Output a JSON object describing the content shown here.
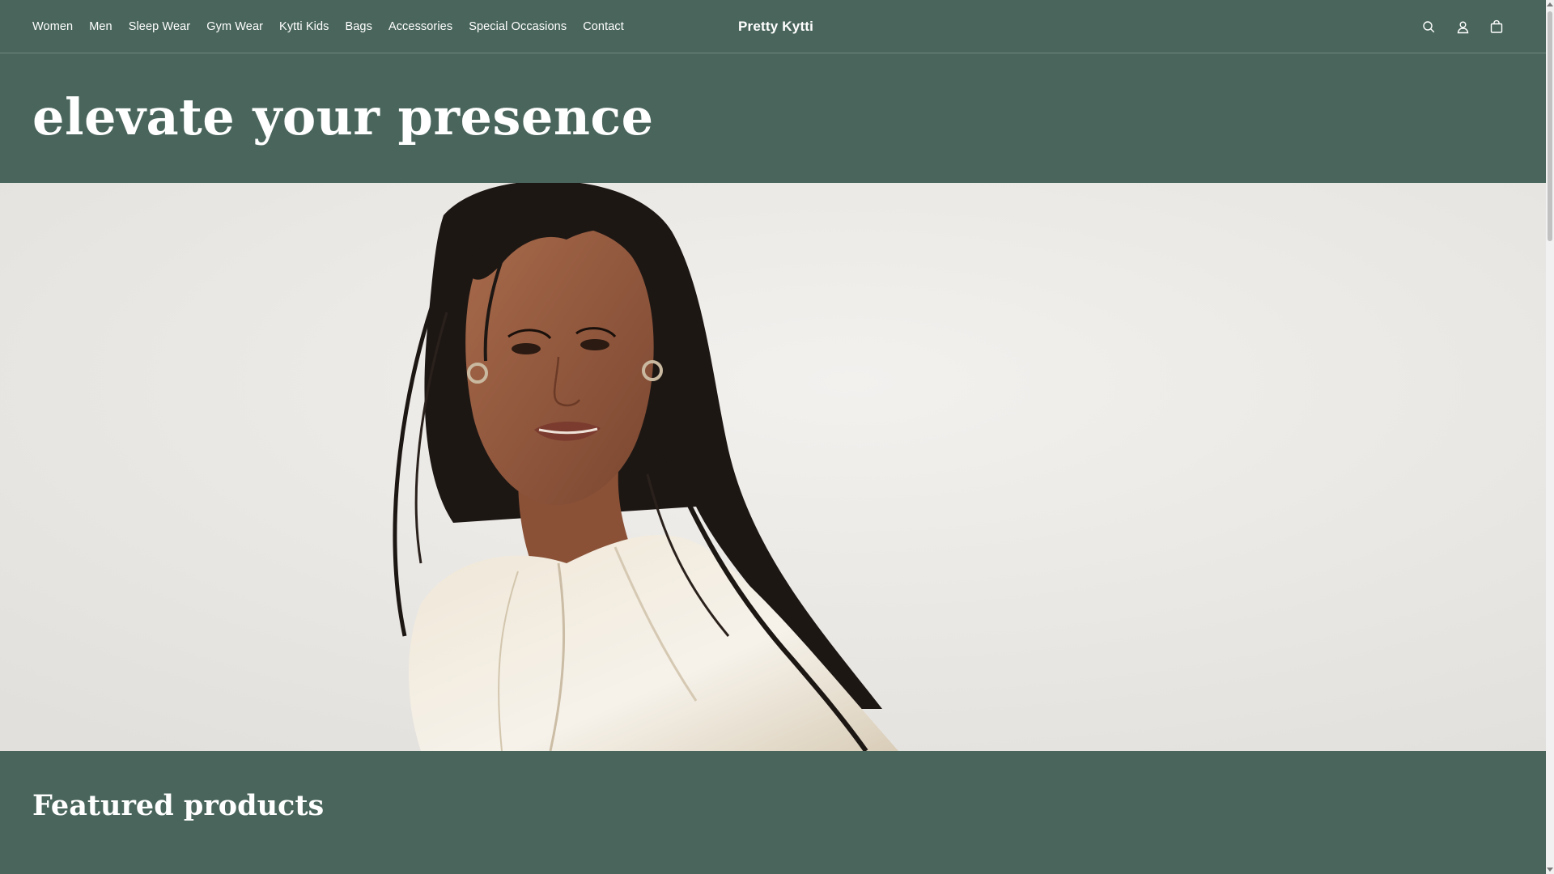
{
  "header": {
    "nav": [
      "Women",
      "Men",
      "Sleep Wear",
      "Gym Wear",
      "Kytti Kids",
      "Bags",
      "Accessories",
      "Special Occasions",
      "Contact"
    ],
    "brand": "Pretty Kytti",
    "icons": [
      "search-icon",
      "account-icon",
      "cart-icon"
    ]
  },
  "hero": {
    "title": "elevate your presence"
  },
  "featured": {
    "title": "Featured products"
  },
  "colors": {
    "background": "#4a665c",
    "text": "#ffffff",
    "hero_backdrop": "#eceae6"
  }
}
